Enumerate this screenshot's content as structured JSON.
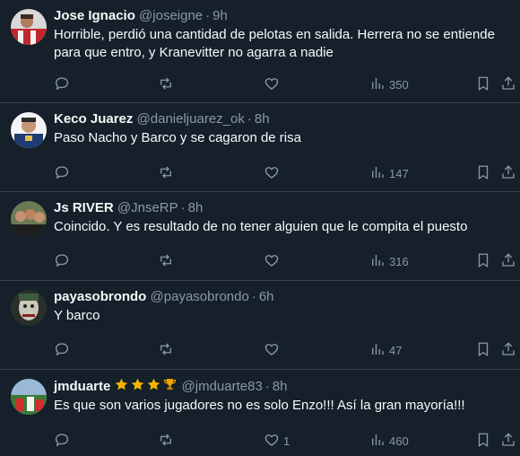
{
  "tweets": [
    {
      "name": "Jose Ignacio",
      "handle": "@joseigne",
      "time": "9h",
      "text": "Horrible, perdió una cantidad de pelotas en salida. Herrera no se entiende para que entro, y Kranevitter no agarra a nadie",
      "likes": "",
      "views": "350"
    },
    {
      "name": "Keco Juarez",
      "handle": "@danieljuarez_ok",
      "time": "8h",
      "text": "Paso Nacho y Barco y se cagaron de risa",
      "likes": "",
      "views": "147"
    },
    {
      "name": "Js RIVER",
      "handle": "@JnseRP",
      "time": "8h",
      "text": "Coincido. Y es resultado de no tener alguien que le compita el puesto",
      "likes": "",
      "views": "316"
    },
    {
      "name": "payasobrondo",
      "handle": "@payasobrondo",
      "time": "6h",
      "text": "Y barco",
      "likes": "",
      "views": "47"
    },
    {
      "name": "jmduarte",
      "handle": "@jmduarte83",
      "time": "8h",
      "text": "Es que son varios jugadores no es solo Enzo!!! Así la gran mayoría!!!",
      "likes": "1",
      "views": "460",
      "badges": [
        "star-icon",
        "star-icon",
        "star-icon",
        "trophy-icon"
      ]
    }
  ],
  "separator": "·",
  "colors": {
    "background": "#15202b",
    "text": "#f7f9f9",
    "muted": "#8b98a5",
    "border": "#38444d",
    "star": "#f4b400",
    "trophy": "#f2a900"
  }
}
